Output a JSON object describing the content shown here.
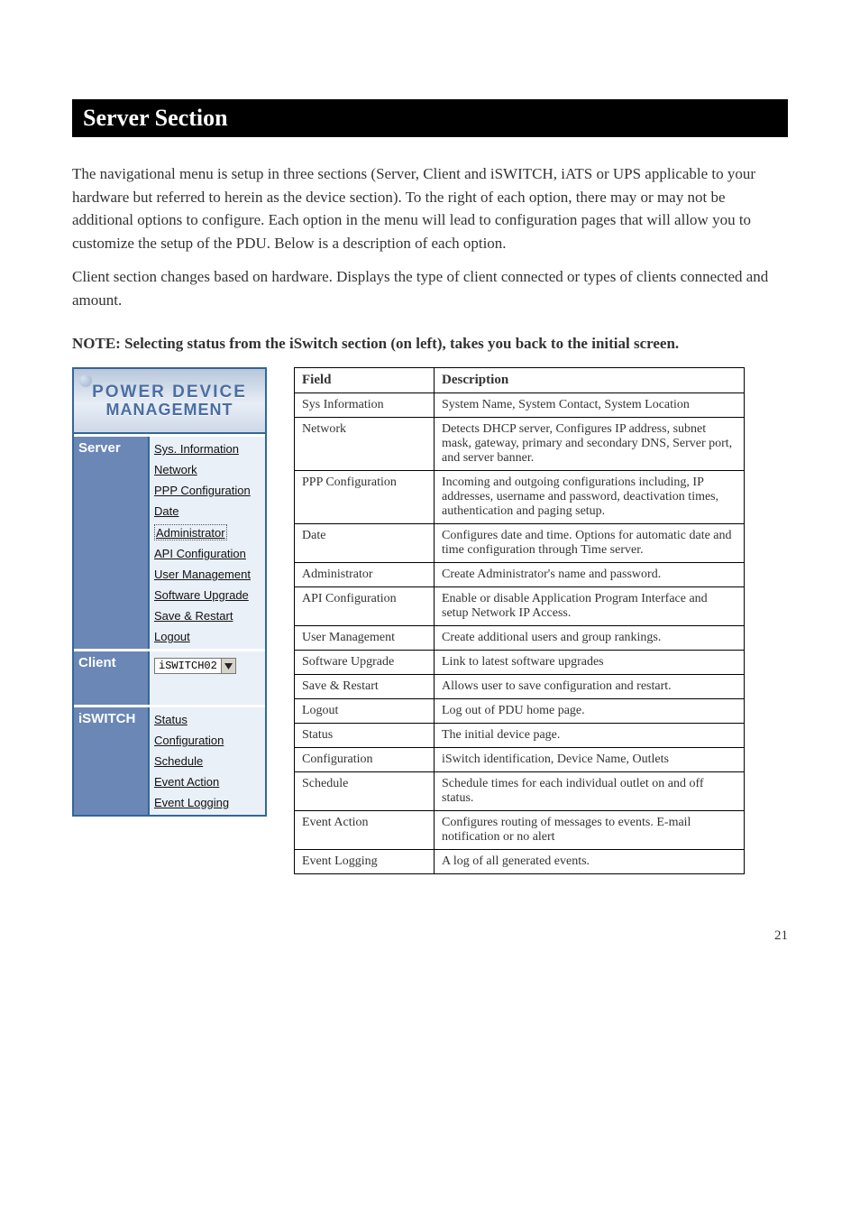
{
  "black_bar": "Server Section",
  "intro_paragraphs": [
    "The navigational menu is setup in three sections (Server, Client and iSWITCH, iATS or UPS applicable to your hardware but referred to herein as the device section). To the right of each option, there may or may not be additional options to configure. Each option in the menu will lead to configuration pages that will allow you to customize the setup of the PDU. Below is a description of each option.",
    "Client section changes based on hardware. Displays the type of client connected or types of clients connected and amount."
  ],
  "note": "NOTE: Selecting status from the iSwitch section (on left), takes you back to the initial screen.",
  "banner_line1": "POWER DEVICE",
  "banner_line2": "MANAGEMENT",
  "sections": {
    "server": {
      "label": "Server",
      "items": [
        "Sys. Information",
        "Network",
        "PPP Configuration",
        "Date",
        "Administrator",
        "API Configuration",
        "User Management",
        "Software Upgrade",
        "Save & Restart",
        "Logout"
      ]
    },
    "client": {
      "label": "Client",
      "select_value": "iSWITCH02"
    },
    "iswitch": {
      "label": "iSWITCH",
      "items": [
        "Status",
        "Configuration",
        "Schedule",
        "Event Action",
        "Event Logging"
      ]
    }
  },
  "table_headers": {
    "field": "Field",
    "desc": "Description"
  },
  "table_rows": [
    {
      "field": "Sys Information",
      "desc": "System Name, System Contact, System Location"
    },
    {
      "field": "Network",
      "desc": "Detects DHCP server, Configures IP address, subnet mask, gateway, primary and secondary DNS, Server port, and server banner."
    },
    {
      "field": "PPP Configuration",
      "desc": "Incoming and outgoing configurations including, IP addresses, username and password, deactivation times, authentication and paging setup."
    },
    {
      "field": "Date",
      "desc": "Configures date and time. Options for automatic date and time configuration through Time server."
    },
    {
      "field": "Administrator",
      "desc": "Create Administrator's name and password."
    },
    {
      "field": "API Configuration",
      "desc": "Enable or disable Application Program Interface and setup Network IP Access."
    },
    {
      "field": "User Management",
      "desc": "Create additional users and group rankings."
    },
    {
      "field": "Software Upgrade",
      "desc": "Link to latest software upgrades"
    },
    {
      "field": "Save & Restart",
      "desc": "Allows user to save configuration and restart."
    },
    {
      "field": "Logout",
      "desc": "Log out of PDU home page."
    },
    {
      "field": "Status",
      "desc": "The initial device page."
    },
    {
      "field": "Configuration",
      "desc": "iSwitch identification, Device Name, Outlets"
    },
    {
      "field": "Schedule",
      "desc": "Schedule times for each individual outlet on and off status."
    },
    {
      "field": "Event Action",
      "desc": "Configures routing of messages to events. E-mail notification or no alert"
    },
    {
      "field": "Event Logging",
      "desc": "A log of all generated events."
    }
  ],
  "page_number": "21"
}
